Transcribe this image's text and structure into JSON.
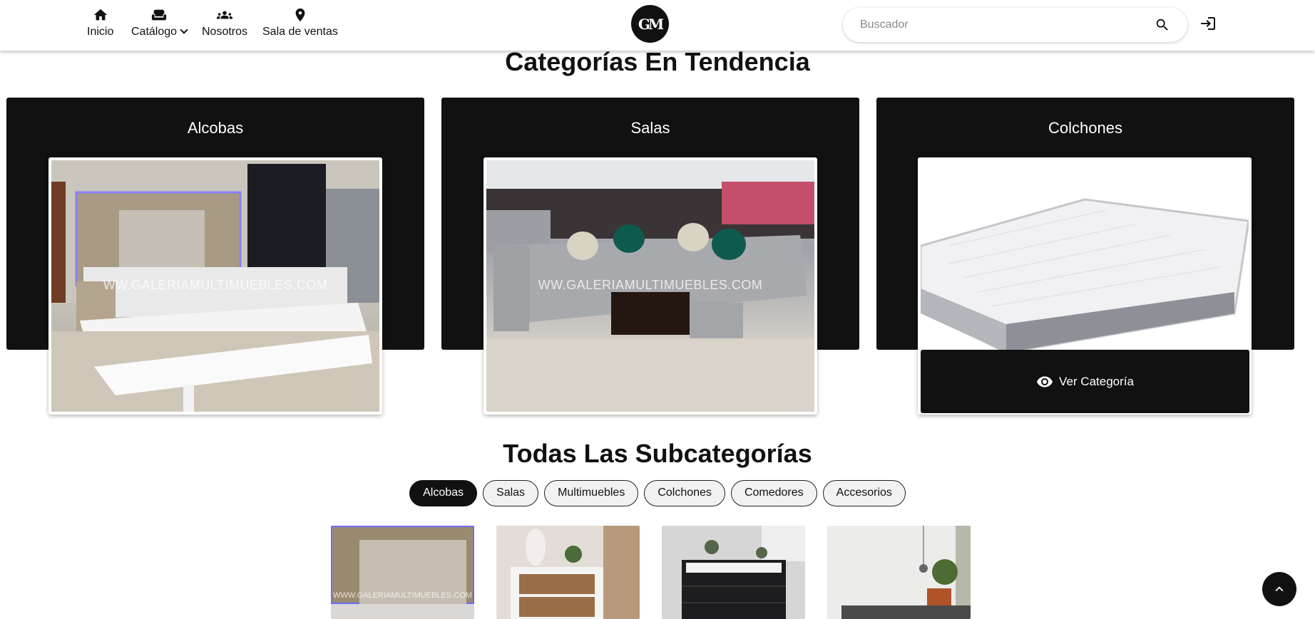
{
  "nav": {
    "items": [
      {
        "label": "Inicio",
        "icon": "home-icon"
      },
      {
        "label": "Catálogo",
        "icon": "sofa-icon"
      },
      {
        "label": "Nosotros",
        "icon": "group-icon"
      },
      {
        "label": "Sala de ventas",
        "icon": "location-pin-icon"
      }
    ],
    "logo_text": "GM"
  },
  "search": {
    "placeholder": "Buscador"
  },
  "trending": {
    "title": "Categorías En Tendencia",
    "categories": [
      {
        "name": "Alcobas",
        "watermark": "WW.GALERIAMULTIMUEBLES.COM"
      },
      {
        "name": "Salas",
        "watermark": "WW.GALERIAMULTIMUEBLES.COM"
      },
      {
        "name": "Colchones"
      }
    ],
    "view_button": "Ver Categoría"
  },
  "subcategories": {
    "title": "Todas Las Subcategorías",
    "pills": [
      "Alcobas",
      "Salas",
      "Multimuebles",
      "Colchones",
      "Comedores",
      "Accesorios"
    ],
    "active": "Alcobas",
    "thumb_watermark": "WWW.GALERIAMULTIMUEBLES.COM"
  },
  "colors": {
    "primary": "#111111",
    "pill_bg": "#f2f2f2",
    "background": "#ffffff"
  }
}
